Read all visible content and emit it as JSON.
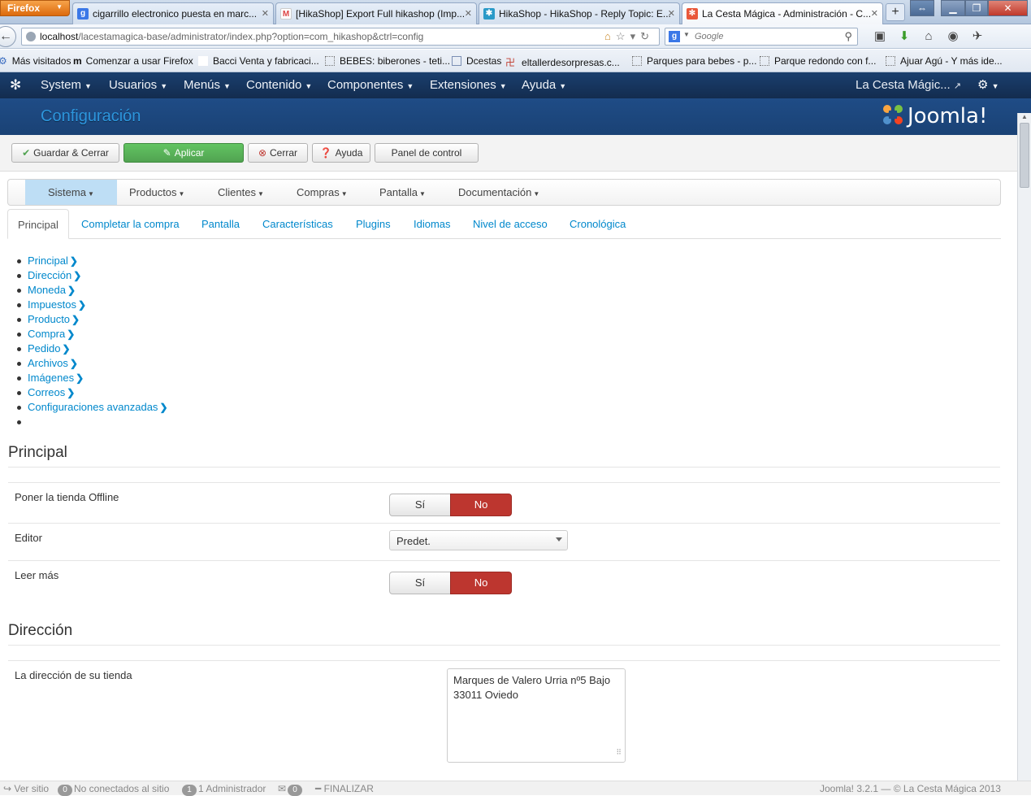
{
  "browser": {
    "app_button": "Firefox",
    "tabs": [
      {
        "label": "cigarrillo electronico puesta en marc...",
        "favicon": "google-icon"
      },
      {
        "label": "[HikaShop] Export Full hikashop (Imp...",
        "favicon": "gmail-icon"
      },
      {
        "label": "HikaShop - HikaShop - Reply Topic: E...",
        "favicon": "hikashop-icon"
      },
      {
        "label": "La Cesta Mágica - Administración - C...",
        "favicon": "joomla-icon"
      }
    ],
    "url_host": "localhost",
    "url_path": "/lacestamagica-base/administrator/index.php?option=com_hikashop&ctrl=config",
    "search_placeholder": "Google",
    "bookmarks": [
      "Más visitados",
      "Comenzar a usar Firefox",
      "Bacci Venta y fabricaci...",
      "BEBES: biberones - teti...",
      "Dcestas",
      "eltallerdesorpresas.c...",
      "Parques para bebes - p...",
      "Parque redondo con f...",
      "Ajuar Agú - Y más ide..."
    ]
  },
  "joomla": {
    "menu": [
      "System",
      "Usuarios",
      "Menús",
      "Contenido",
      "Componentes",
      "Extensiones",
      "Ayuda"
    ],
    "site_name": "La Cesta Mágic...",
    "page_title": "Configuración",
    "brand": "Joomla!",
    "toolbar": {
      "save_close": "Guardar & Cerrar",
      "apply": "Aplicar",
      "close": "Cerrar",
      "help": "Ayuda",
      "dashboard": "Panel de control"
    },
    "submenu": [
      "Sistema",
      "Productos",
      "Clientes",
      "Compras",
      "Pantalla",
      "Documentación"
    ],
    "tabs": [
      "Principal",
      "Completar la compra",
      "Pantalla",
      "Características",
      "Plugins",
      "Idiomas",
      "Nivel de acceso",
      "Cronológica"
    ],
    "anchors": [
      "Principal",
      "Dirección",
      "Moneda",
      "Impuestos",
      "Producto",
      "Compra",
      "Pedido",
      "Archivos",
      "Imágenes",
      "Correos",
      "Configuraciones avanzadas"
    ],
    "sections": {
      "principal": {
        "title": "Principal",
        "offline_label": "Poner la tienda Offline",
        "editor_label": "Editor",
        "editor_value": "Predet.",
        "readmore_label": "Leer más",
        "yes": "Sí",
        "no": "No"
      },
      "direccion": {
        "title": "Dirección",
        "address_label": "La dirección de su tienda",
        "address_line1": "Marques de Valero Urria nº5 Bajo",
        "address_line2": "33011 Oviedo"
      }
    },
    "status": {
      "view_site": "Ver sitio",
      "visitors_count": "0",
      "visitors_label": "No conectados al sitio",
      "admins_count": "1",
      "admins_label": "1 Administrador",
      "messages_count": "0",
      "logout": "FINALIZAR",
      "version": "Joomla! 3.2.1",
      "copyright": "— © La Cesta Mágica 2013"
    }
  }
}
